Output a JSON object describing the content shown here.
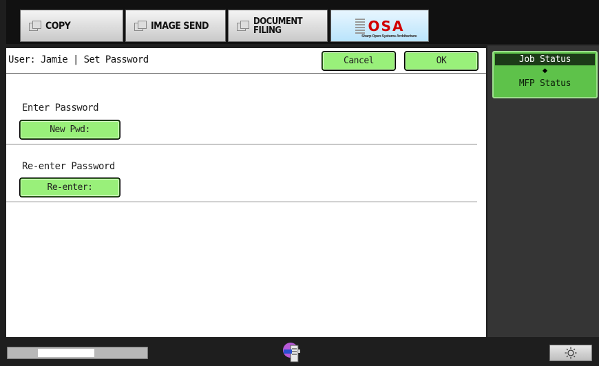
{
  "tabs": {
    "copy": "COPY",
    "image_send": "IMAGE SEND",
    "document_filing": "DOCUMENT\nFILING",
    "osa_logo": "OSA",
    "osa_subtitle": "Sharp Open Systems Architecture"
  },
  "header": {
    "title": "User: Jamie | Set Password",
    "cancel_label": "Cancel",
    "ok_label": "OK"
  },
  "form": {
    "enter_label": "Enter Password",
    "enter_button": "New Pwd:",
    "reenter_label": "Re-enter Password",
    "reenter_button": "Re-enter:"
  },
  "side": {
    "job_status": "Job Status",
    "arrow": "◆",
    "mfp_status": "MFP Status"
  },
  "bottom": {
    "progress_fraction": 0.4,
    "brightness_icon": "sun-icon"
  },
  "colors": {
    "button_green": "#99f07a",
    "side_panel": "#353535",
    "osa_red": "#d10000"
  }
}
